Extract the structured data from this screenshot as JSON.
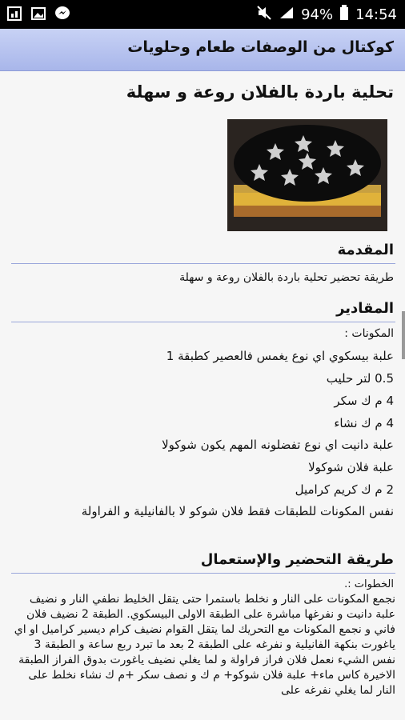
{
  "status_bar": {
    "battery": "94%",
    "time": "14:54"
  },
  "app": {
    "title": "كوكتال من الوصفات طعام وحلويات"
  },
  "recipe": {
    "title": "تحلية باردة بالفلان روعة و سهلة",
    "intro_heading": "المقدمة",
    "intro_text": "طريقة تحضير تحلية باردة بالفلان روعة و سهلة",
    "ingredients_heading": "المقادير",
    "ingredients": [
      "المكونات :",
      "علبة بيسكوي اي نوع يغمس فالعصير كطبقة 1",
      "0.5 لتر حليب",
      "4 م ك سكر",
      "4 م ك نشاء",
      "علبة دانيت اي نوع تفضلونه المهم يكون شوكولا",
      "علبة فلان شوكولا",
      "2 م ك كريم كراميل",
      "نفس المكونات للطبقات فقط فلان شوكو لا بالفانيلية و الفراولة"
    ],
    "method_heading": "طريقة التحضير والإستعمال",
    "steps_label": "الخطوات :.",
    "steps_text": "نجمع المكونات على النار و نخلط باستمرا حتى يتقل الخليط نطفي النار و نضيف علبة دانيت و نفرغها مباشرة على الطبقة الاولى البيسكوي. الطبقة 2 نضيف فلان فاني و نجمع المكونات مع التحريك لما يتقل القوام نضيف كرام ديسير كراميل او اي ياغورت بنكهة الفانيلية و نفرغه على الطبقة 2 بعد ما تبرد ربع ساعة و الطبقة 3 نفس الشيء نعمل فلان فراز فراولة و لما يغلي نضيف ياغورت بدوق الفراز الطبقة الاخيرة كاس ماء+ علبة فلان شوكو+ م ك و نصف سكر +م ك نشاء نخلط على النار لما يغلي نفرغه على"
  },
  "colors": {
    "appbar": "#b4c0ee",
    "rule": "#9aa6db"
  }
}
